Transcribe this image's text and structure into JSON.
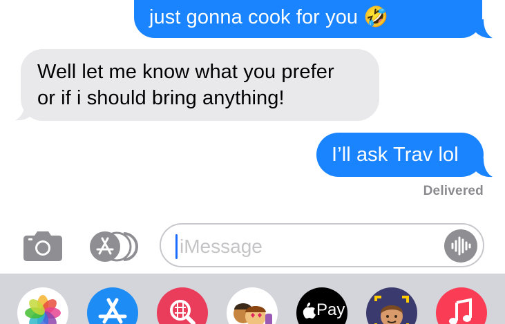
{
  "messages": [
    {
      "direction": "outgoing",
      "text": "just gonna cook for you",
      "emoji": "🤣"
    },
    {
      "direction": "incoming",
      "line1": "Well let me know what you prefer",
      "line2": "or if i should bring anything!"
    },
    {
      "direction": "outgoing",
      "text": "I’ll ask Trav lol"
    }
  ],
  "status": "Delivered",
  "input": {
    "placeholder": "iMessage"
  },
  "apps": [
    {
      "name": "photos-icon"
    },
    {
      "name": "app-store-icon"
    },
    {
      "name": "search-images-icon"
    },
    {
      "name": "memoji-stickers-icon"
    },
    {
      "name": "apple-pay-icon",
      "label": "Pay"
    },
    {
      "name": "memoji-icon"
    },
    {
      "name": "music-icon"
    }
  ],
  "colors": {
    "outgoing_bubble": "#1a84ff",
    "incoming_bubble": "#e9e9eb",
    "tray_background": "#d4d5da",
    "caret": "#1a6cff"
  }
}
